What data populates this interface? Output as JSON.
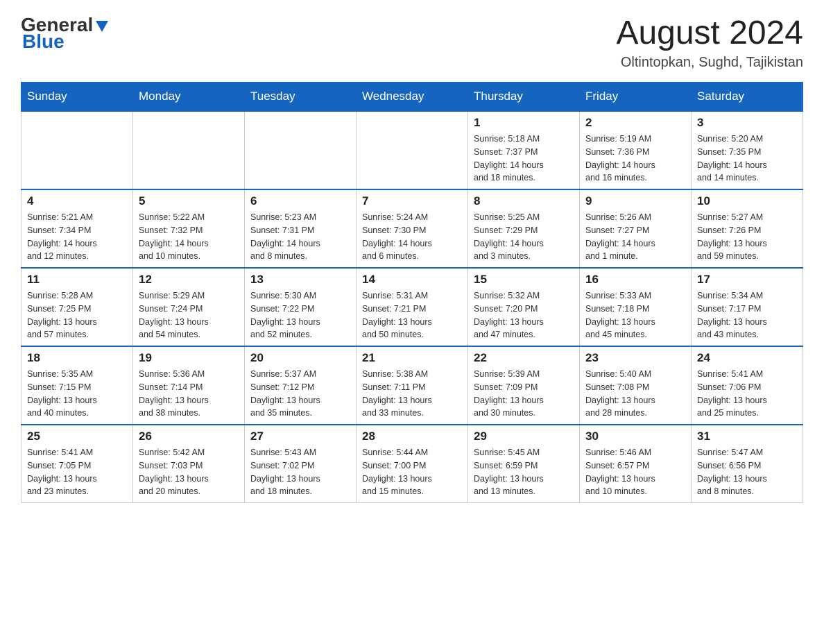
{
  "header": {
    "logo_general": "General",
    "logo_blue": "Blue",
    "month_title": "August 2024",
    "location": "Oltintopkan, Sughd, Tajikistan"
  },
  "days_of_week": [
    "Sunday",
    "Monday",
    "Tuesday",
    "Wednesday",
    "Thursday",
    "Friday",
    "Saturday"
  ],
  "weeks": [
    [
      {
        "day": "",
        "info": ""
      },
      {
        "day": "",
        "info": ""
      },
      {
        "day": "",
        "info": ""
      },
      {
        "day": "",
        "info": ""
      },
      {
        "day": "1",
        "info": "Sunrise: 5:18 AM\nSunset: 7:37 PM\nDaylight: 14 hours\nand 18 minutes."
      },
      {
        "day": "2",
        "info": "Sunrise: 5:19 AM\nSunset: 7:36 PM\nDaylight: 14 hours\nand 16 minutes."
      },
      {
        "day": "3",
        "info": "Sunrise: 5:20 AM\nSunset: 7:35 PM\nDaylight: 14 hours\nand 14 minutes."
      }
    ],
    [
      {
        "day": "4",
        "info": "Sunrise: 5:21 AM\nSunset: 7:34 PM\nDaylight: 14 hours\nand 12 minutes."
      },
      {
        "day": "5",
        "info": "Sunrise: 5:22 AM\nSunset: 7:32 PM\nDaylight: 14 hours\nand 10 minutes."
      },
      {
        "day": "6",
        "info": "Sunrise: 5:23 AM\nSunset: 7:31 PM\nDaylight: 14 hours\nand 8 minutes."
      },
      {
        "day": "7",
        "info": "Sunrise: 5:24 AM\nSunset: 7:30 PM\nDaylight: 14 hours\nand 6 minutes."
      },
      {
        "day": "8",
        "info": "Sunrise: 5:25 AM\nSunset: 7:29 PM\nDaylight: 14 hours\nand 3 minutes."
      },
      {
        "day": "9",
        "info": "Sunrise: 5:26 AM\nSunset: 7:27 PM\nDaylight: 14 hours\nand 1 minute."
      },
      {
        "day": "10",
        "info": "Sunrise: 5:27 AM\nSunset: 7:26 PM\nDaylight: 13 hours\nand 59 minutes."
      }
    ],
    [
      {
        "day": "11",
        "info": "Sunrise: 5:28 AM\nSunset: 7:25 PM\nDaylight: 13 hours\nand 57 minutes."
      },
      {
        "day": "12",
        "info": "Sunrise: 5:29 AM\nSunset: 7:24 PM\nDaylight: 13 hours\nand 54 minutes."
      },
      {
        "day": "13",
        "info": "Sunrise: 5:30 AM\nSunset: 7:22 PM\nDaylight: 13 hours\nand 52 minutes."
      },
      {
        "day": "14",
        "info": "Sunrise: 5:31 AM\nSunset: 7:21 PM\nDaylight: 13 hours\nand 50 minutes."
      },
      {
        "day": "15",
        "info": "Sunrise: 5:32 AM\nSunset: 7:20 PM\nDaylight: 13 hours\nand 47 minutes."
      },
      {
        "day": "16",
        "info": "Sunrise: 5:33 AM\nSunset: 7:18 PM\nDaylight: 13 hours\nand 45 minutes."
      },
      {
        "day": "17",
        "info": "Sunrise: 5:34 AM\nSunset: 7:17 PM\nDaylight: 13 hours\nand 43 minutes."
      }
    ],
    [
      {
        "day": "18",
        "info": "Sunrise: 5:35 AM\nSunset: 7:15 PM\nDaylight: 13 hours\nand 40 minutes."
      },
      {
        "day": "19",
        "info": "Sunrise: 5:36 AM\nSunset: 7:14 PM\nDaylight: 13 hours\nand 38 minutes."
      },
      {
        "day": "20",
        "info": "Sunrise: 5:37 AM\nSunset: 7:12 PM\nDaylight: 13 hours\nand 35 minutes."
      },
      {
        "day": "21",
        "info": "Sunrise: 5:38 AM\nSunset: 7:11 PM\nDaylight: 13 hours\nand 33 minutes."
      },
      {
        "day": "22",
        "info": "Sunrise: 5:39 AM\nSunset: 7:09 PM\nDaylight: 13 hours\nand 30 minutes."
      },
      {
        "day": "23",
        "info": "Sunrise: 5:40 AM\nSunset: 7:08 PM\nDaylight: 13 hours\nand 28 minutes."
      },
      {
        "day": "24",
        "info": "Sunrise: 5:41 AM\nSunset: 7:06 PM\nDaylight: 13 hours\nand 25 minutes."
      }
    ],
    [
      {
        "day": "25",
        "info": "Sunrise: 5:41 AM\nSunset: 7:05 PM\nDaylight: 13 hours\nand 23 minutes."
      },
      {
        "day": "26",
        "info": "Sunrise: 5:42 AM\nSunset: 7:03 PM\nDaylight: 13 hours\nand 20 minutes."
      },
      {
        "day": "27",
        "info": "Sunrise: 5:43 AM\nSunset: 7:02 PM\nDaylight: 13 hours\nand 18 minutes."
      },
      {
        "day": "28",
        "info": "Sunrise: 5:44 AM\nSunset: 7:00 PM\nDaylight: 13 hours\nand 15 minutes."
      },
      {
        "day": "29",
        "info": "Sunrise: 5:45 AM\nSunset: 6:59 PM\nDaylight: 13 hours\nand 13 minutes."
      },
      {
        "day": "30",
        "info": "Sunrise: 5:46 AM\nSunset: 6:57 PM\nDaylight: 13 hours\nand 10 minutes."
      },
      {
        "day": "31",
        "info": "Sunrise: 5:47 AM\nSunset: 6:56 PM\nDaylight: 13 hours\nand 8 minutes."
      }
    ]
  ]
}
